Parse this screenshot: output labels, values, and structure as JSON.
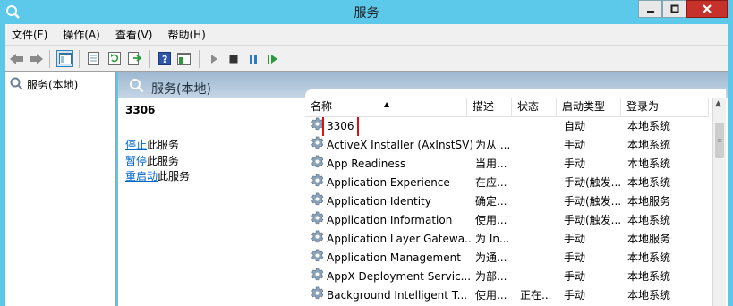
{
  "window": {
    "title": "服务"
  },
  "menu": [
    {
      "label": "文件(F)"
    },
    {
      "label": "操作(A)"
    },
    {
      "label": "查看(V)"
    },
    {
      "label": "帮助(H)"
    }
  ],
  "toolbar": {
    "icons": [
      "back-arrow-icon",
      "forward-arrow-icon",
      "show-hide-tree-icon",
      "properties-icon",
      "refresh-icon",
      "export-icon",
      "help-icon",
      "console-tree-icon",
      "start-service-icon",
      "stop-service-icon",
      "pause-service-icon",
      "restart-service-icon"
    ]
  },
  "tree": {
    "root_label": "服务(本地)"
  },
  "pane": {
    "title": "服务(本地)"
  },
  "detail": {
    "title": "3306",
    "actions": [
      {
        "link": "停止",
        "suffix": "此服务"
      },
      {
        "link": "暂停",
        "suffix": "此服务"
      },
      {
        "link": "重启动",
        "suffix": "此服务"
      }
    ]
  },
  "list": {
    "columns": [
      "名称",
      "描述",
      "状态",
      "启动类型",
      "登录为"
    ],
    "rows": [
      {
        "name": "3306",
        "desc": "",
        "status": "",
        "start": "自动",
        "logon": "本地系统"
      },
      {
        "name": "ActiveX Installer (AxInstSV)",
        "desc": "为从 ...",
        "status": "",
        "start": "手动",
        "logon": "本地系统"
      },
      {
        "name": "App Readiness",
        "desc": "当用...",
        "status": "",
        "start": "手动",
        "logon": "本地系统"
      },
      {
        "name": "Application Experience",
        "desc": "在应...",
        "status": "",
        "start": "手动(触发...",
        "logon": "本地系统"
      },
      {
        "name": "Application Identity",
        "desc": "确定...",
        "status": "",
        "start": "手动(触发...",
        "logon": "本地服务"
      },
      {
        "name": "Application Information",
        "desc": "使用...",
        "status": "",
        "start": "手动(触发...",
        "logon": "本地系统"
      },
      {
        "name": "Application Layer Gatewa...",
        "desc": "为 In...",
        "status": "",
        "start": "手动",
        "logon": "本地服务"
      },
      {
        "name": "Application Management",
        "desc": "为通...",
        "status": "",
        "start": "手动",
        "logon": "本地系统"
      },
      {
        "name": "AppX Deployment Servic...",
        "desc": "为部...",
        "status": "",
        "start": "手动",
        "logon": "本地系统"
      },
      {
        "name": "Background Intelligent T...",
        "desc": "使用...",
        "status": "正在...",
        "start": "手动",
        "logon": "本地系统"
      }
    ]
  },
  "colors": {
    "titlebar": "#5cc8ea",
    "close": "#c7312b",
    "link": "#0066cc",
    "highlight": "#dd1111"
  }
}
